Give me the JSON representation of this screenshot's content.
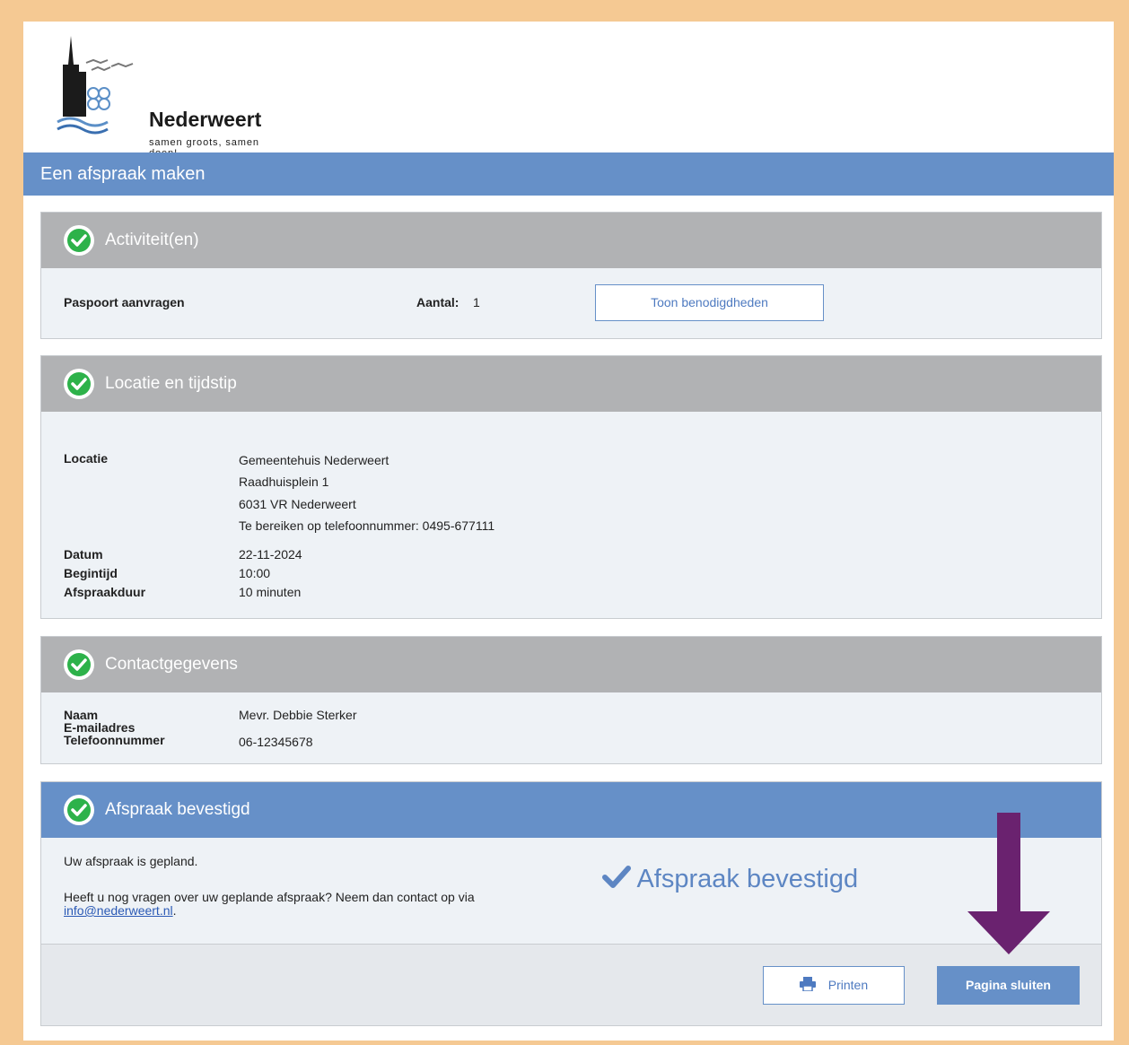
{
  "logo": {
    "name": "Nederweert",
    "tagline": "samen groots, samen doen!"
  },
  "page_title": "Een afspraak maken",
  "activities": {
    "title": "Activiteit(en)",
    "item": "Paspoort aanvragen",
    "count_label": "Aantal:",
    "count_value": "1",
    "requirements_button": "Toon benodigdheden"
  },
  "location": {
    "title": "Locatie en tijdstip",
    "location_label": "Locatie",
    "address_lines": [
      "Gemeentehuis Nederweert",
      "Raadhuisplein 1",
      "6031 VR Nederweert",
      "Te bereiken op telefoonnummer: 0495-677111"
    ],
    "date_label": "Datum",
    "date_value": "22-11-2024",
    "start_label": "Begintijd",
    "start_value": "10:00",
    "duration_label": "Afspraakduur",
    "duration_value": "10 minuten"
  },
  "contact": {
    "title": "Contactgegevens",
    "name_label": "Naam",
    "name_value": "Mevr. Debbie Sterker",
    "email_label": "E-mailadres",
    "phone_label": "Telefoonnummer",
    "phone_value": "06-12345678"
  },
  "confirmation": {
    "title": "Afspraak bevestigd",
    "planned_text": "Uw afspraak is gepland.",
    "question_text": "Heeft u nog vragen over uw geplande afspraak? Neem dan contact op via",
    "email_link": "info@nederweert.nl",
    "after_link": ".",
    "big_status": "Afspraak bevestigd",
    "print_button": "Printen",
    "close_button": "Pagina sluiten"
  },
  "colors": {
    "accent": "#6690c8",
    "section_header": "#b1b2b4",
    "check": "#2db24a",
    "arrow": "#6a226f",
    "frame": "#f5c993"
  },
  "icons": {
    "section_check": "check-circle-icon",
    "print": "printer-icon",
    "status": "checkmark-icon",
    "annotation": "arrow-down-icon"
  }
}
